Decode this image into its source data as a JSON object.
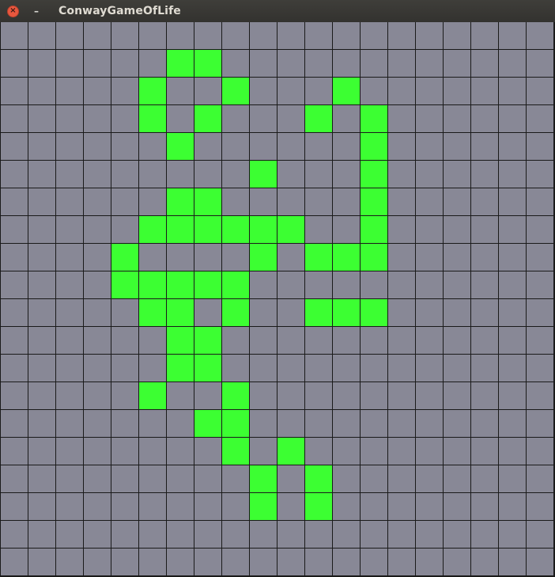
{
  "window": {
    "title": "ConwayGameOfLife",
    "close_glyph": "×",
    "minimize_glyph": "–",
    "close_icon": "close-icon",
    "minimize_icon": "minimize-icon"
  },
  "board": {
    "rows": 20,
    "cols": 20,
    "colors": {
      "dead": "#888896",
      "alive": "#3cff32",
      "gridline": "#1a1a1a"
    },
    "alive_cells": [
      [
        1,
        6
      ],
      [
        1,
        7
      ],
      [
        2,
        5
      ],
      [
        2,
        8
      ],
      [
        2,
        12
      ],
      [
        3,
        5
      ],
      [
        3,
        7
      ],
      [
        3,
        11
      ],
      [
        3,
        13
      ],
      [
        4,
        6
      ],
      [
        4,
        13
      ],
      [
        5,
        9
      ],
      [
        5,
        13
      ],
      [
        6,
        6
      ],
      [
        6,
        7
      ],
      [
        6,
        13
      ],
      [
        7,
        5
      ],
      [
        7,
        6
      ],
      [
        7,
        7
      ],
      [
        7,
        8
      ],
      [
        7,
        9
      ],
      [
        7,
        10
      ],
      [
        7,
        13
      ],
      [
        8,
        4
      ],
      [
        8,
        9
      ],
      [
        8,
        11
      ],
      [
        8,
        12
      ],
      [
        8,
        13
      ],
      [
        9,
        4
      ],
      [
        9,
        5
      ],
      [
        9,
        6
      ],
      [
        9,
        7
      ],
      [
        9,
        8
      ],
      [
        10,
        5
      ],
      [
        10,
        6
      ],
      [
        10,
        8
      ],
      [
        10,
        11
      ],
      [
        10,
        12
      ],
      [
        10,
        13
      ],
      [
        11,
        6
      ],
      [
        11,
        7
      ],
      [
        12,
        6
      ],
      [
        12,
        7
      ],
      [
        13,
        5
      ],
      [
        13,
        8
      ],
      [
        14,
        7
      ],
      [
        14,
        8
      ],
      [
        15,
        8
      ],
      [
        15,
        10
      ],
      [
        16,
        9
      ],
      [
        16,
        11
      ],
      [
        17,
        9
      ],
      [
        17,
        11
      ]
    ]
  }
}
